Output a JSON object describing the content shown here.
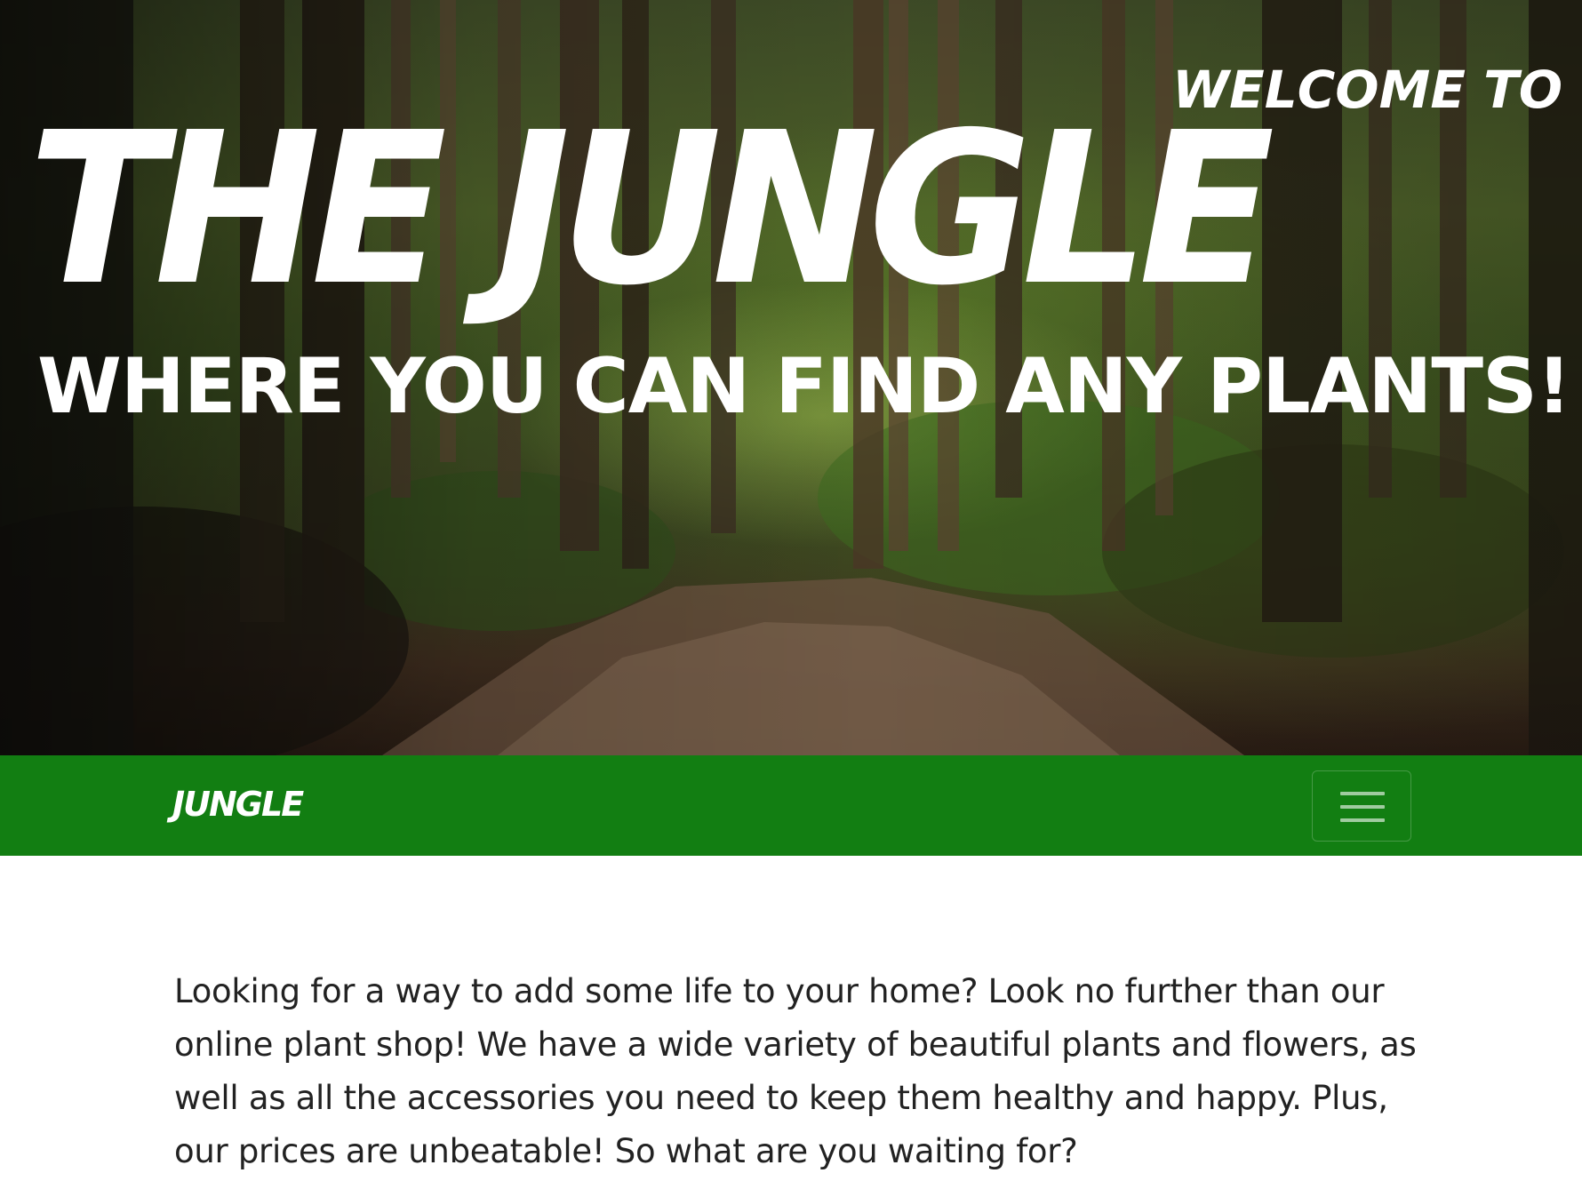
{
  "hero": {
    "welcome": "WELCOME TO",
    "title": "THE JUNGLE",
    "subtitle": "WHERE YOU CAN FIND ANY PLANTS!"
  },
  "navbar": {
    "brand": "JUNGLE",
    "background_color": "#127e12",
    "toggler_icon": "hamburger-menu-icon"
  },
  "content": {
    "intro": "Looking for a way to add some life to your home? Look no further than our online plant shop! We have a wide variety of beautiful plants and flowers, as well as all the accessories you need to keep them healthy and happy. Plus, our prices are unbeatable! So what are you waiting for?"
  }
}
